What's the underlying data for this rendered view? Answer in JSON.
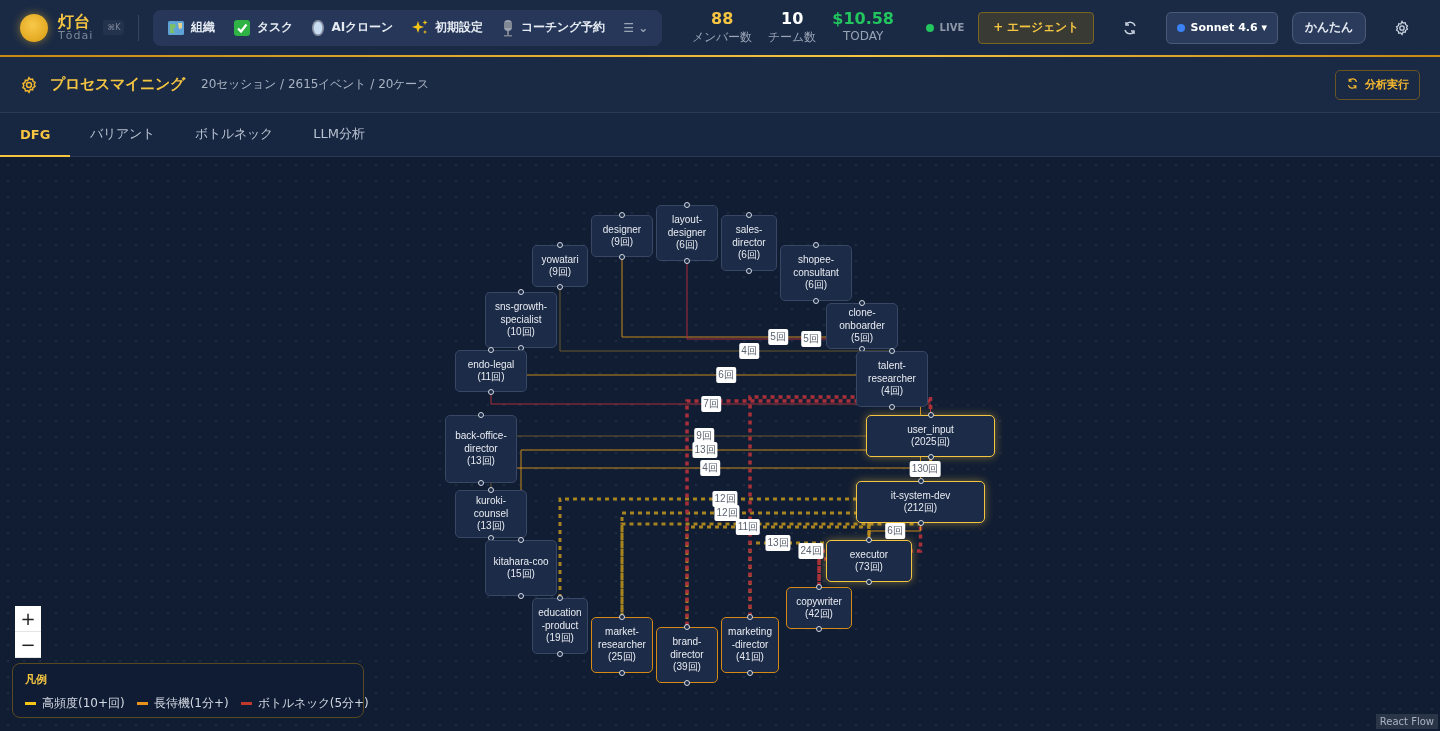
{
  "brand": {
    "name": "灯台",
    "romaji": "Tōdai",
    "shortcut": "⌘K"
  },
  "nav": [
    {
      "label": "組織"
    },
    {
      "label": "タスク"
    },
    {
      "label": "AIクローン"
    },
    {
      "label": "初期設定"
    },
    {
      "label": "コーチング予約"
    }
  ],
  "nav_more": {
    "label": "☰",
    "caret": "⌄"
  },
  "stats": [
    {
      "value": "88",
      "label": "メンバー数",
      "color": "#f5c542"
    },
    {
      "value": "10",
      "label": "チーム数",
      "color": "#ffffff"
    },
    {
      "value": "$10.58",
      "label": "TODAY",
      "color": "#22c55e"
    }
  ],
  "live": {
    "label": "LIVE",
    "on": true
  },
  "add_agent": {
    "icon": "+",
    "label": "エージェント"
  },
  "model": {
    "label": "Sonnet 4.6",
    "caret": "▾"
  },
  "mode_button": "かんたん",
  "page": {
    "title": "プロセスマイニング",
    "summary": "20セッション / 2615イベント / 20ケース",
    "run_button": "分析実行"
  },
  "tabs": [
    {
      "label": "DFG",
      "selected": true
    },
    {
      "label": "バリアント",
      "selected": false
    },
    {
      "label": "ボトルネック",
      "selected": false
    },
    {
      "label": "LLM分析",
      "selected": false
    }
  ],
  "nodes": [
    {
      "name": "designer",
      "count": "(9回)",
      "kind": "normal"
    },
    {
      "name": "layout-designer",
      "count": "(6回)",
      "kind": "normal"
    },
    {
      "name": "sales-director",
      "count": "(6回)",
      "kind": "normal"
    },
    {
      "name": "yowatari",
      "count": "(9回)",
      "kind": "normal"
    },
    {
      "name": "shopee-consultant",
      "count": "(6回)",
      "kind": "normal"
    },
    {
      "name": "sns-growth-specialist",
      "count": "(10回)",
      "kind": "normal"
    },
    {
      "name": "clone-onboarder",
      "count": "(5回)",
      "kind": "normal"
    },
    {
      "name": "endo-legal",
      "count": "(11回)",
      "kind": "normal"
    },
    {
      "name": "talent-researcher",
      "count": "(4回)",
      "kind": "normal"
    },
    {
      "name": "back-office-director",
      "count": "(13回)",
      "kind": "normal"
    },
    {
      "name": "user_input",
      "count": "(2025回)",
      "kind": "hot"
    },
    {
      "name": "kuroki-counsel",
      "count": "(13回)",
      "kind": "normal"
    },
    {
      "name": "it-system-dev",
      "count": "(212回)",
      "kind": "hot"
    },
    {
      "name": "kitahara-coo",
      "count": "(15回)",
      "kind": "normal"
    },
    {
      "name": "executor",
      "count": "(73回)",
      "kind": "hot"
    },
    {
      "name": "education-product",
      "count": "(19回)",
      "kind": "normal"
    },
    {
      "name": "copywriter",
      "count": "(42回)",
      "kind": "busy"
    },
    {
      "name": "market-researcher",
      "count": "(25回)",
      "kind": "busy"
    },
    {
      "name": "marketing-director",
      "count": "(41回)",
      "kind": "busy"
    },
    {
      "name": "brand-director",
      "count": "(39回)",
      "kind": "busy"
    }
  ],
  "edges": [
    {
      "label": "5回",
      "kind": "wait"
    },
    {
      "label": "5回",
      "kind": "bottleneck"
    },
    {
      "label": "4回",
      "kind": "normal"
    },
    {
      "label": "6回",
      "kind": "wait"
    },
    {
      "label": "7回",
      "kind": "bottleneck"
    },
    {
      "label": "9回",
      "kind": "normal"
    },
    {
      "label": "13回",
      "kind": "wait"
    },
    {
      "label": "4回",
      "kind": "wait"
    },
    {
      "label": "12回",
      "kind": "frequent"
    },
    {
      "label": "12回",
      "kind": "frequent"
    },
    {
      "label": "11回",
      "kind": "frequent"
    },
    {
      "label": "13回",
      "kind": "frequent"
    },
    {
      "label": "24回",
      "kind": "frequent_bottleneck"
    },
    {
      "label": "6回",
      "kind": "wait"
    },
    {
      "label": "130回",
      "kind": "frequent"
    },
    {
      "kind": "frequent_bottleneck"
    },
    {
      "kind": "frequent_bottleneck"
    },
    {
      "kind": "frequent"
    },
    {
      "kind": "frequent_bottleneck"
    }
  ],
  "legend": {
    "title": "凡例",
    "items": [
      {
        "label": "高頻度(10+回)",
        "color": "#f5c518"
      },
      {
        "label": "長待機(1分+)",
        "color": "#e8941a"
      },
      {
        "label": "ボトルネック(5分+)",
        "color": "#c0392b"
      }
    ]
  },
  "zoom_controls": [
    "+",
    "−"
  ],
  "attribution": "React Flow"
}
